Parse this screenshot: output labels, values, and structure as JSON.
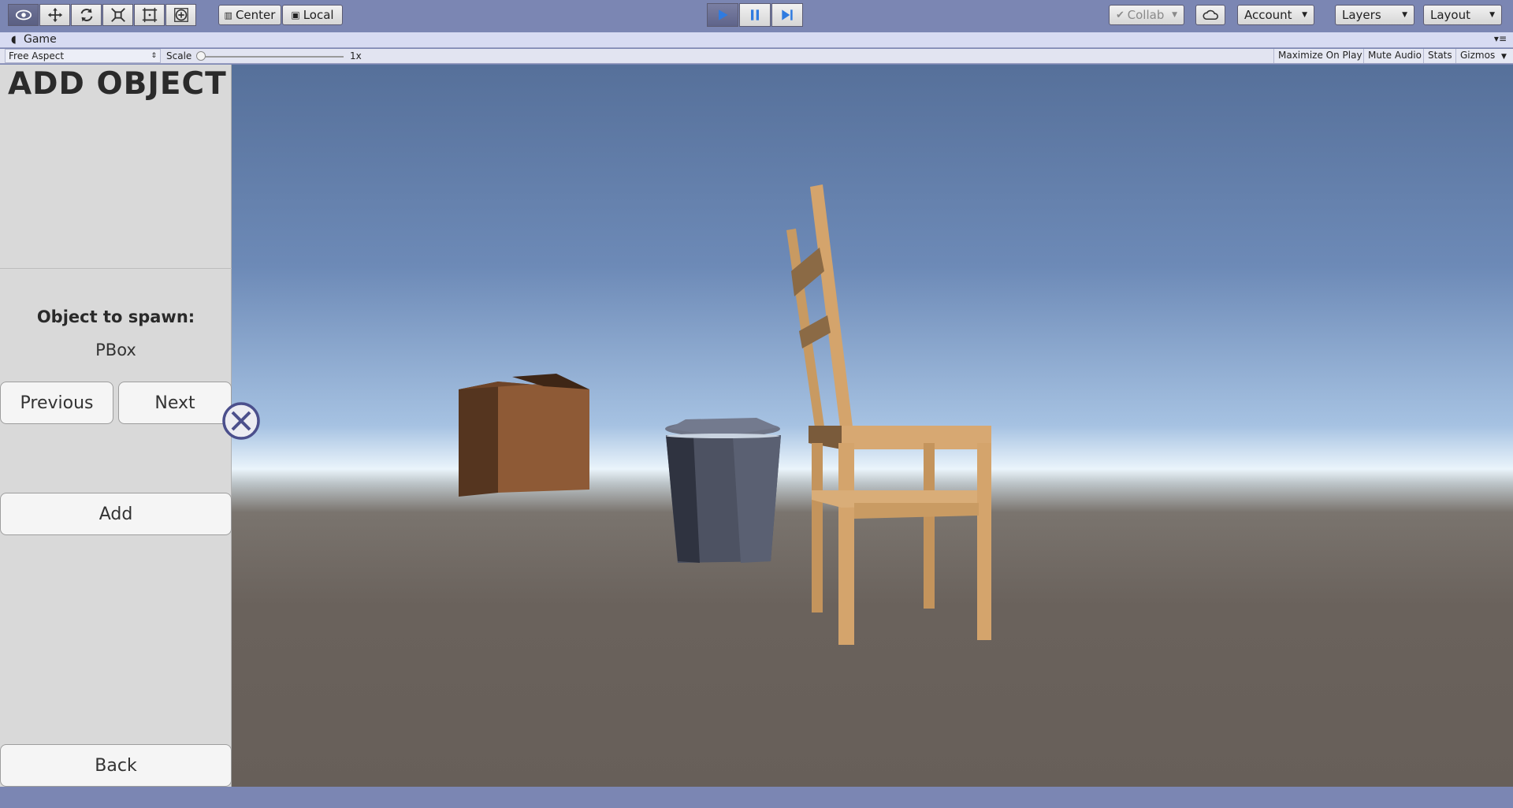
{
  "toolbar": {
    "tools": [
      {
        "icon": "eye-icon",
        "active": true
      },
      {
        "icon": "move-icon",
        "active": false
      },
      {
        "icon": "rotate-icon",
        "active": false
      },
      {
        "icon": "scale-icon",
        "active": false
      },
      {
        "icon": "rect-tool-icon",
        "active": false
      },
      {
        "icon": "transform-tool-icon",
        "active": false
      }
    ],
    "pivot_label": "Center",
    "space_label": "Local",
    "play_state": "playing",
    "collab_label": "Collab",
    "account_label": "Account",
    "layers_label": "Layers",
    "layout_label": "Layout"
  },
  "game_tab": {
    "label": "Game"
  },
  "game_bar": {
    "aspect": "Free Aspect",
    "scale_label": "Scale",
    "scale_value": "1x",
    "maximize_label": "Maximize On Play",
    "mute_label": "Mute Audio",
    "stats_label": "Stats",
    "gizmos_label": "Gizmos"
  },
  "panel": {
    "title": "ADD OBJECT",
    "spawn_label": "Object to spawn:",
    "spawn_value": "PBox",
    "previous_label": "Previous",
    "next_label": "Next",
    "add_label": "Add",
    "back_label": "Back"
  },
  "colors": {
    "editor_chrome": "#7b86b3",
    "panel_bg": "#d9d9d9",
    "box_front": "#8e5a36",
    "box_side": "#55351f",
    "bin": "#4d5262",
    "chair": "#d4a46c"
  }
}
